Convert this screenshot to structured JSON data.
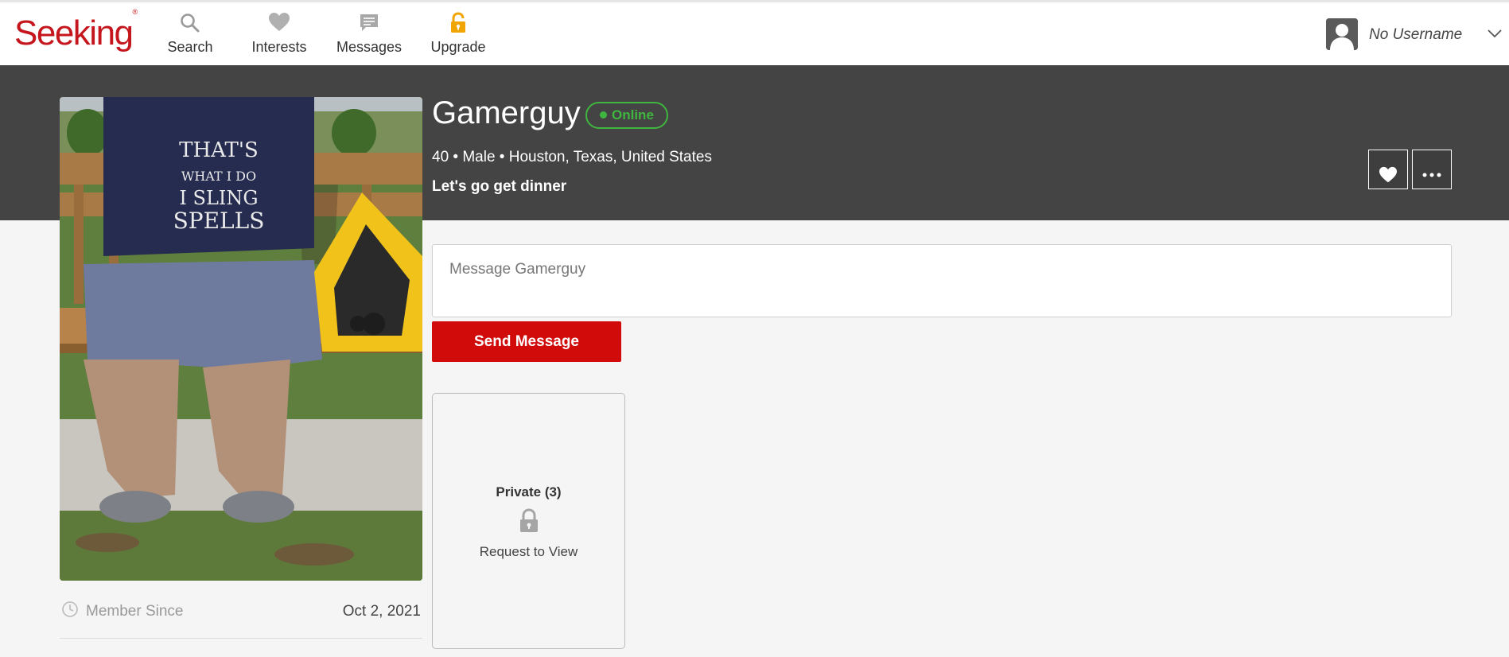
{
  "brand": {
    "logo_text": "Seeking",
    "logo_mark": "®",
    "accent_color": "#c4161c"
  },
  "nav": {
    "items": [
      {
        "label": "Search",
        "icon": "search-icon"
      },
      {
        "label": "Interests",
        "icon": "heart-icon"
      },
      {
        "label": "Messages",
        "icon": "chat-bubble-icon"
      },
      {
        "label": "Upgrade",
        "icon": "unlock-icon"
      }
    ]
  },
  "account": {
    "username": "No Username",
    "avatar_icon": "user-silhouette-icon",
    "menu_icon": "chevron-down-icon"
  },
  "profile": {
    "name": "Gamerguy",
    "status": "Online",
    "status_color": "#3fb63f",
    "details": "40 • Male • Houston, Texas, United States",
    "tagline": "Let's go get dinner",
    "favorite_icon": "heart-icon",
    "more_icon": "more-dots-icon"
  },
  "message": {
    "placeholder": "Message Gamerguy",
    "send_label": "Send Message",
    "send_color": "#d10a0a"
  },
  "private_photos": {
    "title": "Private (3)",
    "icon": "lock-icon",
    "action": "Request to View"
  },
  "member_since": {
    "label": "Member Since",
    "value": "Oct 2, 2021",
    "icon": "clock-icon"
  }
}
